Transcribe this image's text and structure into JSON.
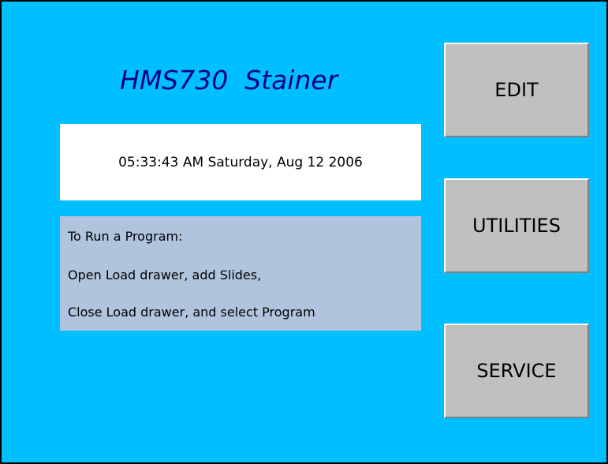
{
  "title": "HMS730  Stainer",
  "datetime": "05:33:43 AM Saturday, Aug 12 2006",
  "instructions": {
    "line1": "To Run a Program:",
    "line2": "Open Load drawer, add Slides,",
    "line3": "Close Load drawer, and select Program"
  },
  "buttons": {
    "edit": "EDIT",
    "utilities": "UTILITIES",
    "service": "SERVICE"
  },
  "colors": {
    "background": "#00bfff",
    "title_text": "#00008b",
    "datetime_box": "#ffffff",
    "instructions_box": "#b0c4de",
    "button_face": "#c0c0c0"
  }
}
